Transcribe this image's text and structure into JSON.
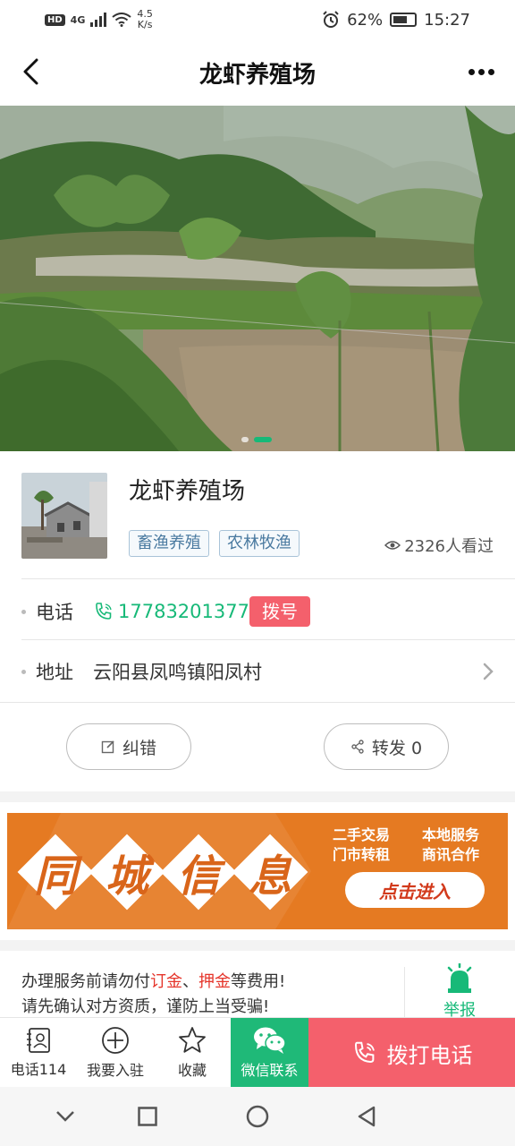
{
  "status_bar": {
    "hd": "HD",
    "network": "4G",
    "speed_value": "4.5",
    "speed_unit": "K/s",
    "battery": "62%",
    "time": "15:27"
  },
  "nav": {
    "title": "龙虾养殖场"
  },
  "carousel": {
    "current_index": 2,
    "total": 2
  },
  "business": {
    "name": "龙虾养殖场",
    "tags": [
      "畜渔养殖",
      "农林牧渔"
    ],
    "views": "2326人看过"
  },
  "contact": {
    "phone_label": "电话",
    "phone": "17783201377",
    "dial_label": "拨号",
    "address_label": "地址",
    "address": "云阳县凤鸣镇阳凤村"
  },
  "actions": {
    "correct_label": "纠错",
    "share_label": "转发 0"
  },
  "banner": {
    "chars": [
      "同",
      "城",
      "信",
      "息"
    ],
    "services": [
      "二手交易",
      "本地服务",
      "门市转租",
      "商讯合作"
    ],
    "enter_label": "点击进入",
    "bg_color": "#e57a22"
  },
  "notice": {
    "line1_prefix": "办理服务前请勿付",
    "line1_red1": "订金",
    "line1_sep": "、",
    "line1_red2": "押金",
    "line1_suffix": "等费用!",
    "line2": "请先确认对方资质，谨防上当受骗!",
    "report_label": "举报"
  },
  "toolbar": {
    "phone114": "电话114",
    "join": "我要入驻",
    "favorite": "收藏",
    "wechat": "微信联系",
    "call": "拨打电话",
    "green": "#1fb978",
    "red": "#f4606c"
  }
}
